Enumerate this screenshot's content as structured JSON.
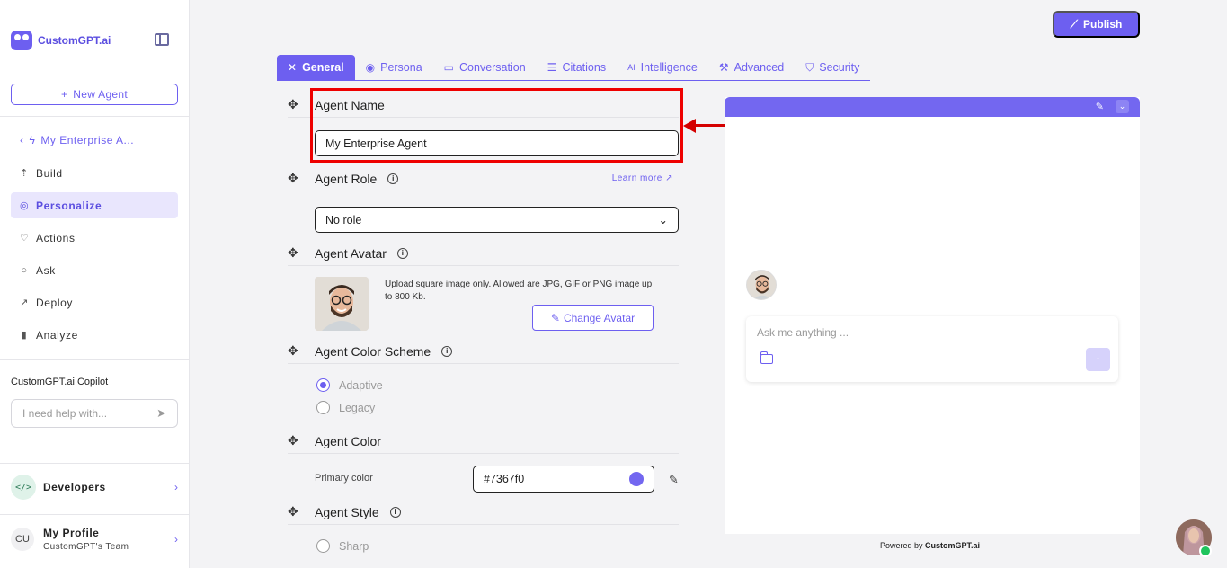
{
  "sidebar": {
    "logo_text": "CustomGPT.ai",
    "new_agent_label": "New Agent",
    "agent_back_label": "My Enterprise A...",
    "items": [
      {
        "label": "Build",
        "icon": "build-icon"
      },
      {
        "label": "Personalize",
        "icon": "palette-icon"
      },
      {
        "label": "Actions",
        "icon": "actions-icon"
      },
      {
        "label": "Ask",
        "icon": "chat-icon"
      },
      {
        "label": "Deploy",
        "icon": "rocket-icon"
      },
      {
        "label": "Analyze",
        "icon": "chart-icon"
      }
    ],
    "copilot_title": "CustomGPT.ai Copilot",
    "copilot_placeholder": "I need help with...",
    "developers_label": "Developers",
    "developers_badge": "</>",
    "profile_initials": "CU",
    "profile_name": "My Profile",
    "profile_team": "CustomGPT's Team"
  },
  "header": {
    "publish_label": "Publish"
  },
  "tabs": [
    {
      "label": "General",
      "active": true
    },
    {
      "label": "Persona"
    },
    {
      "label": "Conversation"
    },
    {
      "label": "Citations"
    },
    {
      "label": "Intelligence"
    },
    {
      "label": "Advanced"
    },
    {
      "label": "Security"
    }
  ],
  "form": {
    "agent_name_title": "Agent Name",
    "agent_name_value": "My Enterprise Agent",
    "agent_role_title": "Agent Role",
    "learn_more": "Learn more",
    "agent_role_value": "No role",
    "agent_avatar_title": "Agent Avatar",
    "upload_text": "Upload square image only. Allowed are JPG, GIF or PNG image up to 800 Kb.",
    "change_avatar_label": "Change Avatar",
    "color_scheme_title": "Agent Color Scheme",
    "scheme_options": [
      {
        "label": "Adaptive",
        "checked": true
      },
      {
        "label": "Legacy",
        "checked": false
      }
    ],
    "agent_color_title": "Agent Color",
    "primary_color_label": "Primary color",
    "primary_color_value": "#7367f0",
    "agent_style_title": "Agent Style",
    "style_option": "Sharp"
  },
  "preview": {
    "chat_placeholder": "Ask me anything ...",
    "powered_prefix": "Powered by",
    "powered_brand": "CustomGPT.ai"
  },
  "colors": {
    "accent": "#6d5ff0",
    "highlight": "#e00000"
  }
}
